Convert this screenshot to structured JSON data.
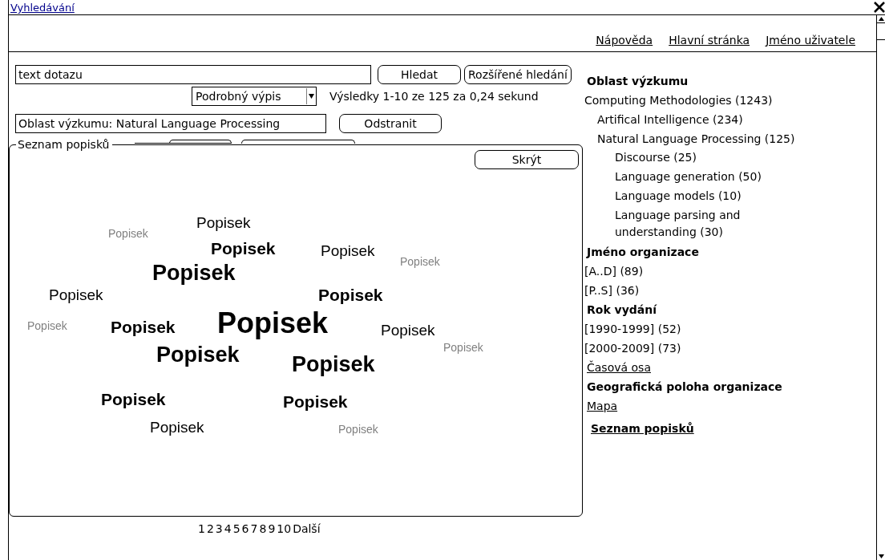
{
  "window": {
    "title": "Vyhledávání"
  },
  "top_links": [
    "Nápověda",
    "Hlavní stránka",
    "Jméno uživatele"
  ],
  "search": {
    "value": "text dotazu",
    "buttons": [
      "Hledat",
      "Rozšířené hledání"
    ]
  },
  "view_select": {
    "value": "Podrobný výpis"
  },
  "results_info": "Výsledky 1-10 ze 125 za 0,24 sekund",
  "filter": {
    "value": "Oblast výzkumu: Natural Language Processing",
    "remove_button": "Odstranit"
  },
  "tag_panel": {
    "title": "Seznam popisků",
    "hide_button": "Skrýt",
    "tags": [
      {
        "text": "Popisek",
        "kind": "faint"
      },
      {
        "text": "Popisek",
        "kind": "normal"
      },
      {
        "text": "Popisek",
        "kind": "bold"
      },
      {
        "text": "Popisek",
        "kind": "normal"
      },
      {
        "text": "Popisek",
        "kind": "faint"
      },
      {
        "text": "Popisek",
        "kind": "large"
      },
      {
        "text": "Popisek",
        "kind": "normal"
      },
      {
        "text": "Popisek",
        "kind": "bold"
      },
      {
        "text": "Popisek",
        "kind": "faint"
      },
      {
        "text": "Popisek",
        "kind": "bold"
      },
      {
        "text": "Popisek",
        "kind": "huge"
      },
      {
        "text": "Popisek",
        "kind": "normal"
      },
      {
        "text": "Popisek",
        "kind": "faint"
      },
      {
        "text": "Popisek",
        "kind": "large"
      },
      {
        "text": "Popisek",
        "kind": "large"
      },
      {
        "text": "Popisek",
        "kind": "bold"
      },
      {
        "text": "Popisek",
        "kind": "bold"
      },
      {
        "text": "Popisek",
        "kind": "normal"
      },
      {
        "text": "Popisek",
        "kind": "faint"
      }
    ]
  },
  "pagination": {
    "pages": [
      "1",
      "2",
      "3",
      "4",
      "5",
      "6",
      "7",
      "8",
      "9",
      "10"
    ],
    "next": "Další"
  },
  "sidebar": {
    "sections": [
      {
        "heading": "Oblast výzkumu",
        "items": [
          {
            "label": "Computing Methodologies (1243)",
            "children": [
              {
                "label": "Artifical Intelligence (234)"
              },
              {
                "label": "Natural Language Processing (125)",
                "children": [
                  {
                    "label": "Discourse (25)"
                  },
                  {
                    "label": "Language generation (50)"
                  },
                  {
                    "label": "Language models (10)"
                  },
                  {
                    "label": "Language parsing and understanding (30)"
                  }
                ]
              }
            ]
          }
        ]
      },
      {
        "heading": "Jméno organizace",
        "items": [
          {
            "label": "[A..D] (89)"
          },
          {
            "label": "[P..S] (36)"
          }
        ]
      },
      {
        "heading": "Rok vydání",
        "items": [
          {
            "label": "[1990-1999] (52)"
          },
          {
            "label": "[2000-2009] (73)"
          }
        ],
        "link": "Časová osa"
      },
      {
        "heading": "Geografická poloha organizace",
        "link": "Mapa"
      }
    ],
    "footer_link": "Seznam popisků"
  }
}
